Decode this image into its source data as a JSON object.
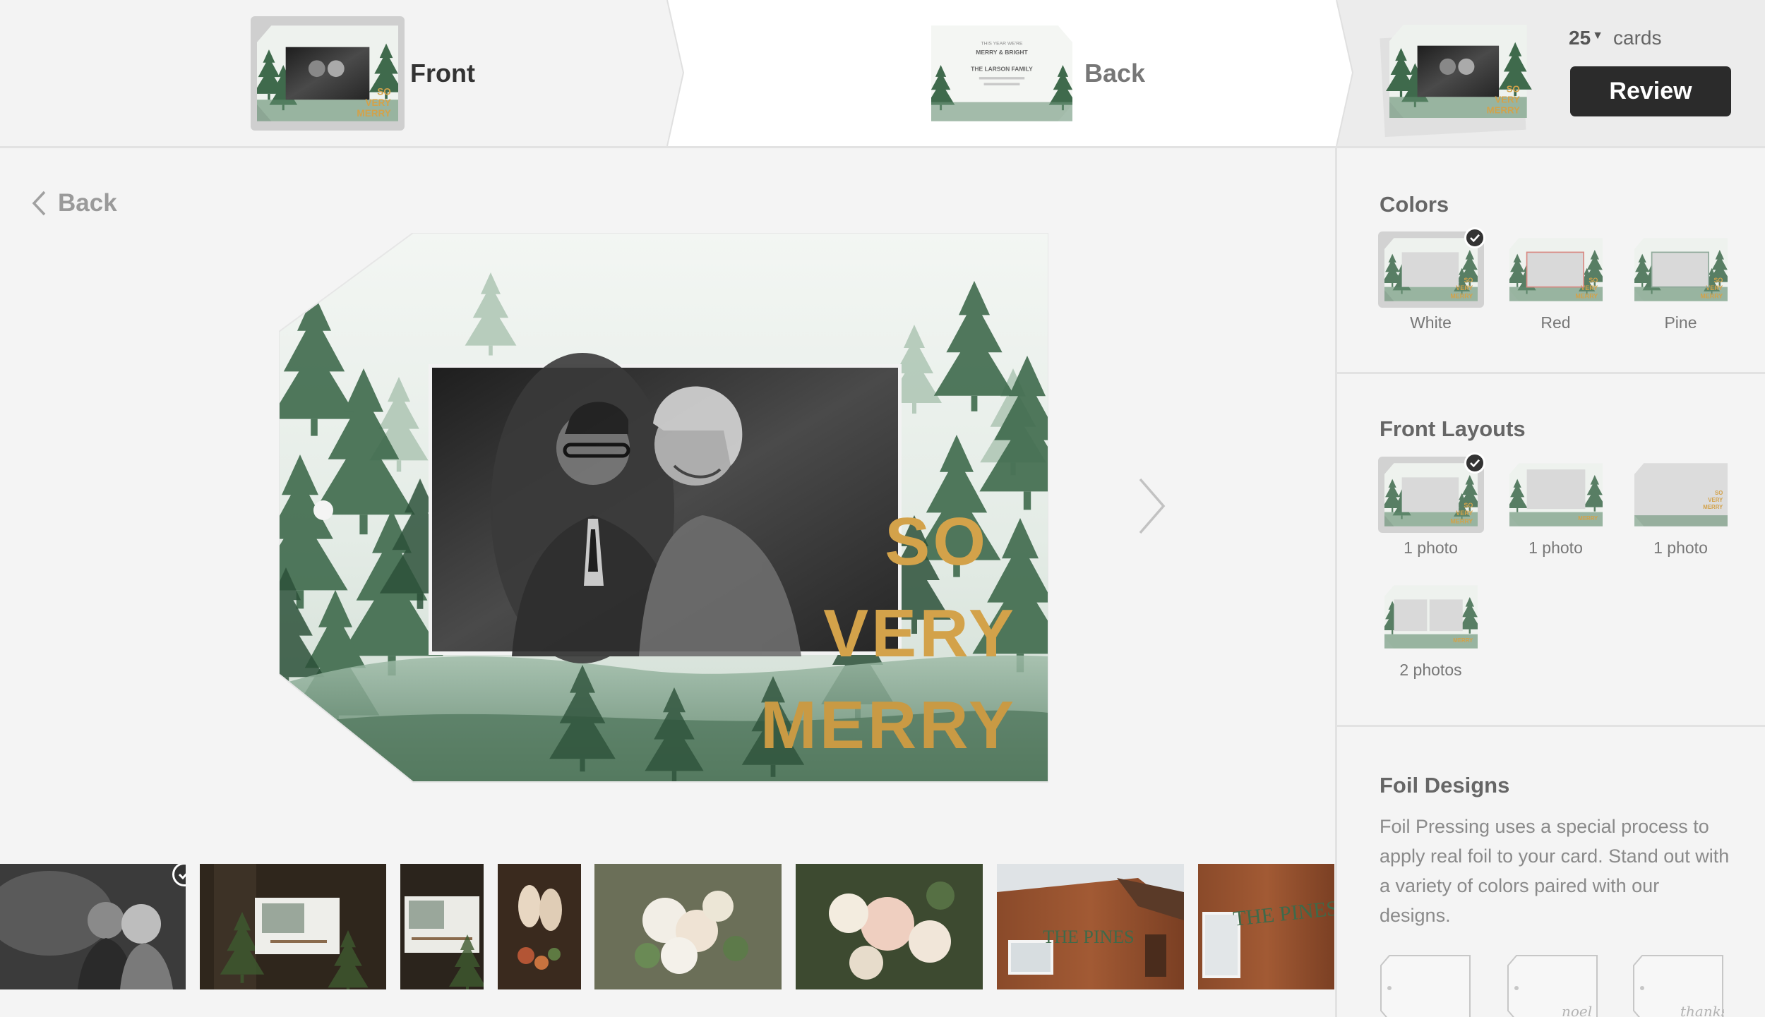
{
  "steps": {
    "front_label": "Front",
    "back_label": "Back"
  },
  "order": {
    "quantity": "25",
    "quantity_unit": "cards",
    "review_label": "Review"
  },
  "nav": {
    "back_label": "Back"
  },
  "card": {
    "foil_line1": "SO",
    "foil_line2": "VERY",
    "foil_line3": "MERRY",
    "back_line1": "THIS YEAR WE'RE",
    "back_line2": "MERRY & BRIGHT",
    "back_line3": "THE LARSON FAMILY",
    "pines_sign": "THE PINES"
  },
  "sidebar": {
    "colors": {
      "title": "Colors",
      "options": [
        {
          "label": "White",
          "selected": true
        },
        {
          "label": "Red",
          "selected": false
        },
        {
          "label": "Pine",
          "selected": false
        }
      ]
    },
    "layouts": {
      "title": "Front Layouts",
      "options": [
        {
          "label": "1 photo",
          "selected": true
        },
        {
          "label": "1 photo",
          "selected": false
        },
        {
          "label": "1 photo",
          "selected": false
        },
        {
          "label": "2 photos",
          "selected": false
        }
      ]
    },
    "foil": {
      "title": "Foil Designs",
      "description": "Foil Pressing uses a special process to apply real foil to your card. Stand out with a variety of colors paired with our designs.",
      "scripts": [
        "noel",
        "thanks"
      ]
    }
  },
  "colors": {
    "accent_dark": "#2b2b2b",
    "foil_gold": "#d3a24a",
    "pine_green": "#3f6a4c"
  }
}
